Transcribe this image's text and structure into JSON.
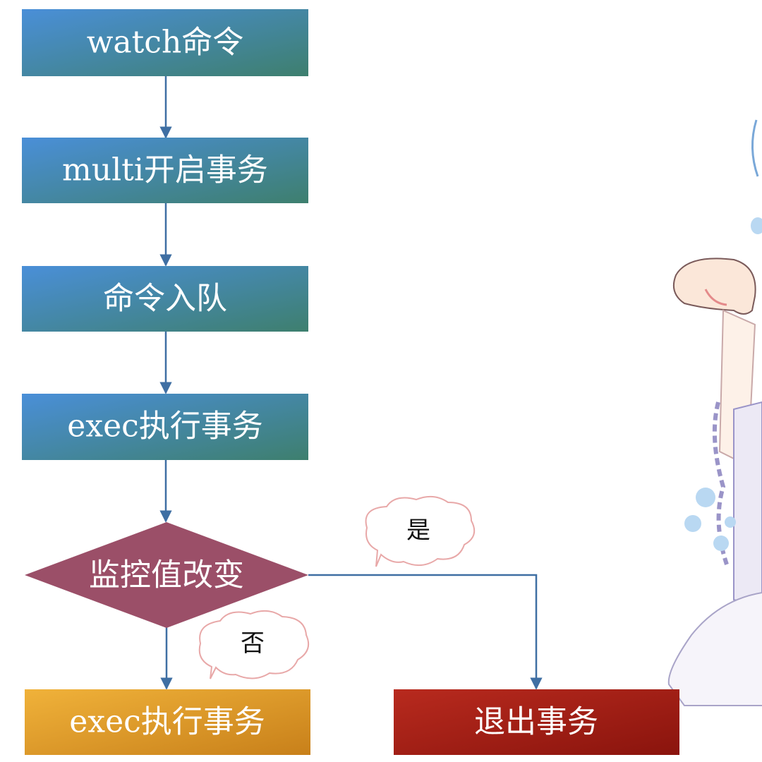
{
  "steps": {
    "watch": "watch命令",
    "multi": "multi开启事务",
    "queue": "命令入队",
    "exec": "exec执行事务",
    "decision": "监控值改变",
    "exec_final": "exec执行事务",
    "exit": "退出事务"
  },
  "branches": {
    "yes": "是",
    "no": "否"
  },
  "colors": {
    "process_start": "#4a8fd8",
    "process_end": "#3e7f72",
    "decision": "#9b4f68",
    "exec_final_start": "#f0b23a",
    "exec_final_end": "#c88018",
    "exit_start": "#b82a1e",
    "exit_end": "#8e150e",
    "arrow": "#3f6fa3",
    "bubble_stroke": "#e8a8a8"
  }
}
